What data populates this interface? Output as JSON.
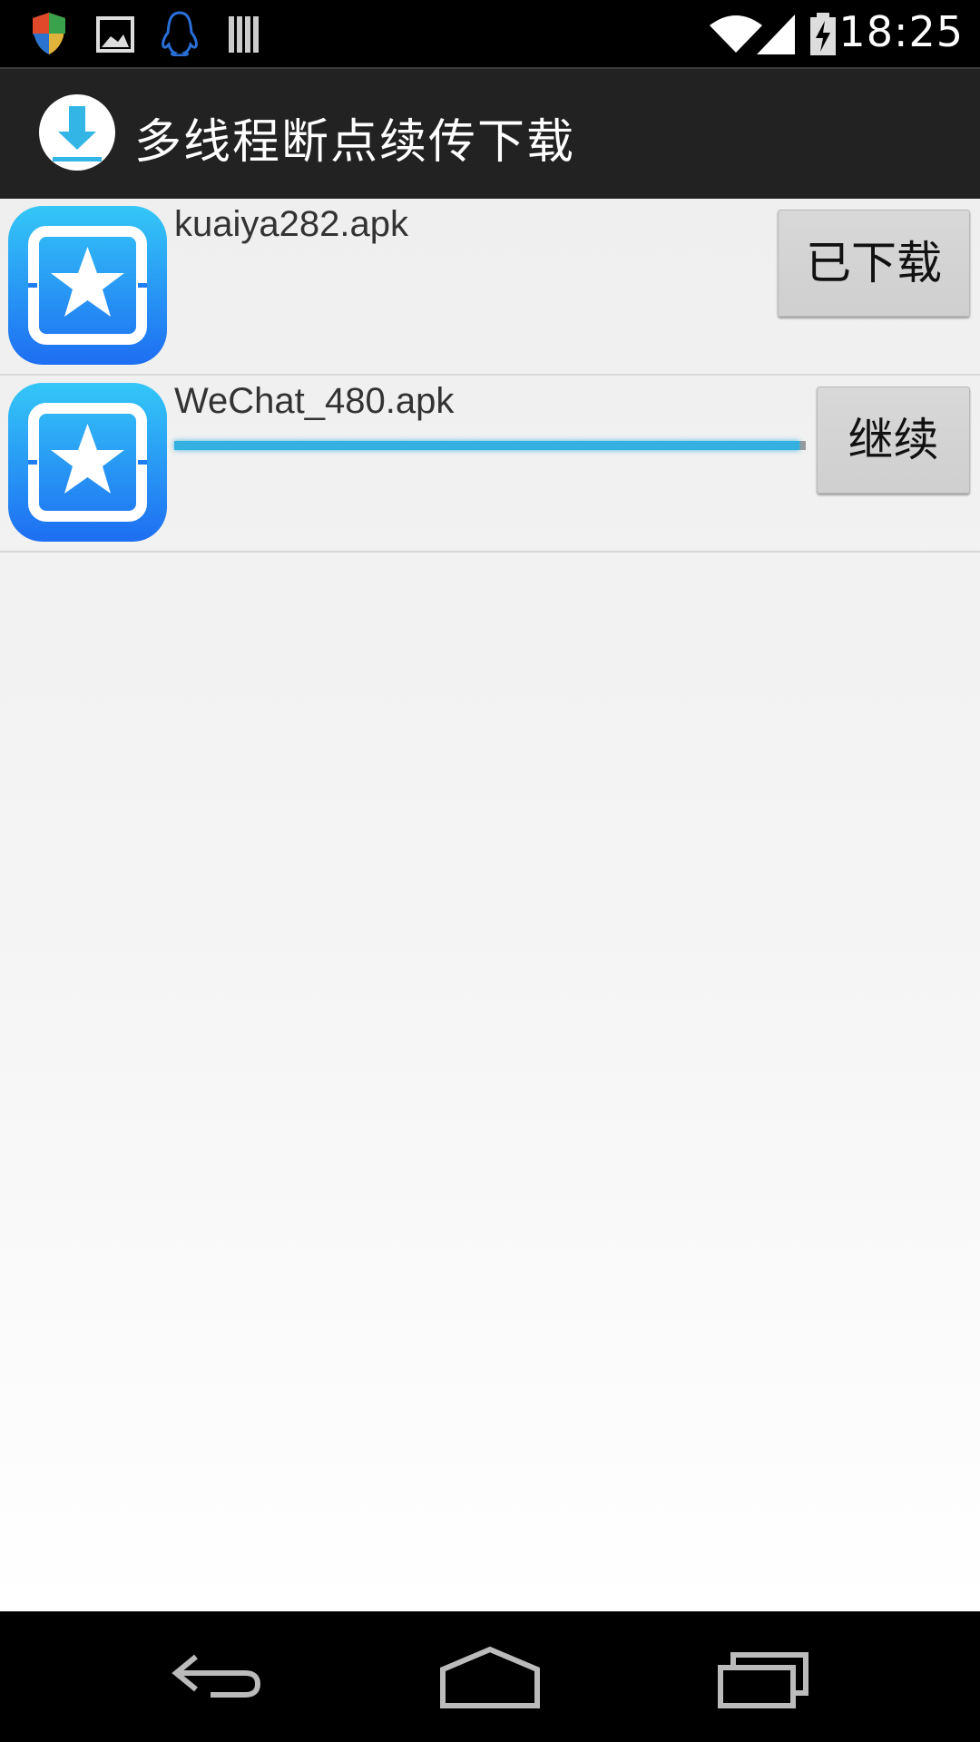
{
  "status_bar": {
    "time": "18:25",
    "icons": [
      "shield-icon",
      "image-icon",
      "qq-penguin-icon",
      "barcode-icon",
      "wifi-icon",
      "signal-icon",
      "battery-charging-icon"
    ]
  },
  "action_bar": {
    "title": "多线程断点续传下载",
    "icon": "download-icon"
  },
  "downloads": [
    {
      "file_name": "kuaiya282.apk",
      "button_label": "已下载",
      "icon": "star-app-icon",
      "progress": null
    },
    {
      "file_name": "WeChat_480.apk",
      "button_label": "继续",
      "icon": "star-app-icon",
      "progress": 0.99
    }
  ],
  "colors": {
    "accent": "#33B5E5",
    "action_bar_bg": "#222222",
    "app_icon_blue": "#1E8CF5"
  },
  "nav_bar": {
    "buttons": [
      "back-icon",
      "home-icon",
      "recent-apps-icon"
    ]
  }
}
